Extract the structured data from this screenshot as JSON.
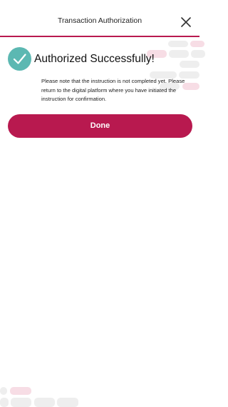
{
  "header": {
    "title": "Transaction Authorization",
    "close_icon": "close-icon"
  },
  "status": {
    "icon": "check-circle-icon",
    "title": "Authorized Successfully!",
    "message": "Please note that the instruction is not completed yet. Please return to the digital platform where you have initiated the instruction for confirmation."
  },
  "actions": {
    "done_label": "Done"
  },
  "colors": {
    "accent": "#b8194f",
    "success": "#5cb8b2",
    "decoration_pink": "#f7dde5",
    "decoration_grey": "#eeeeee"
  }
}
